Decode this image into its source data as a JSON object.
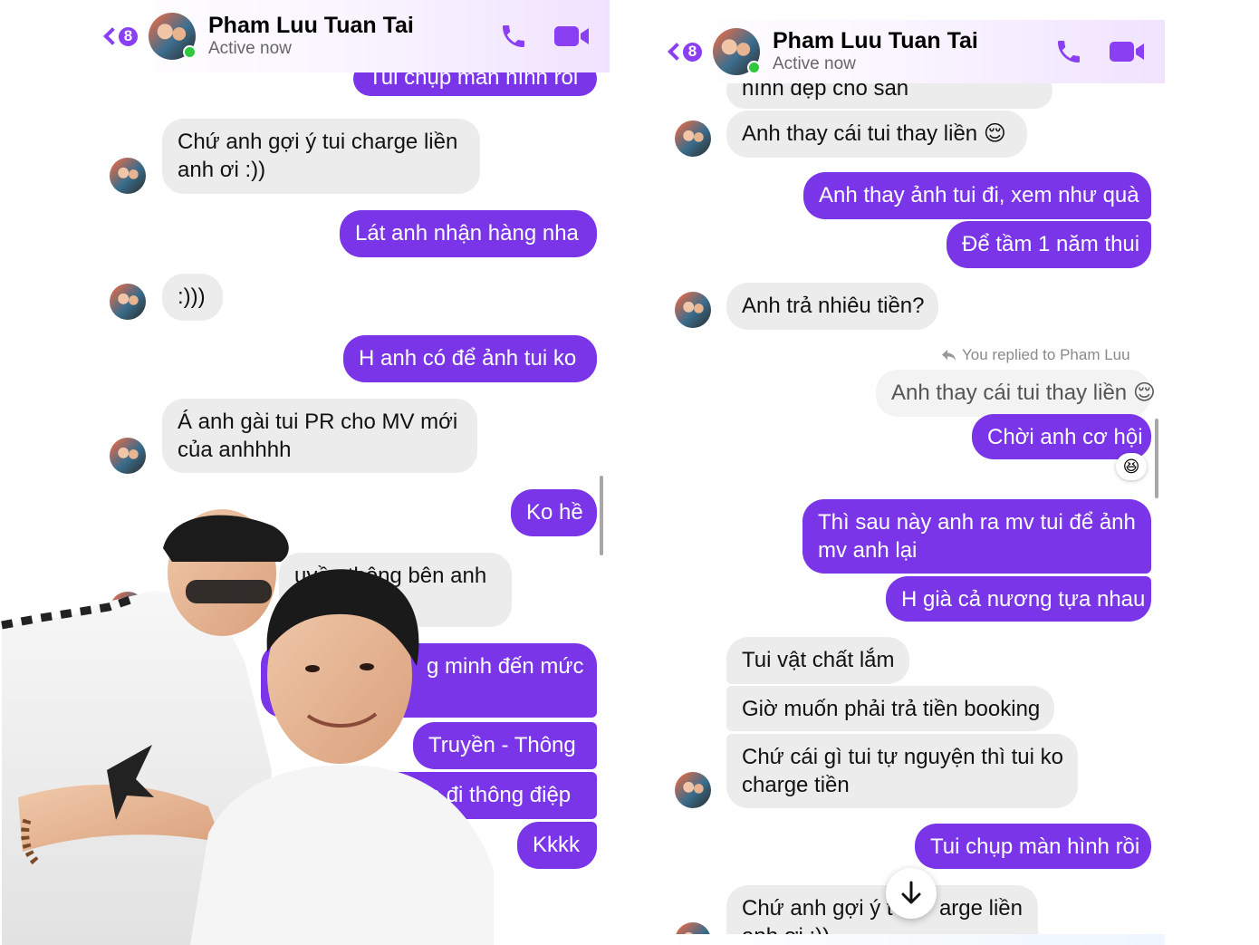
{
  "colors": {
    "accent": "#7a35e8",
    "header_icon": "#8a3ff2",
    "incoming_bubble": "#ececec",
    "online": "#31c840"
  },
  "left": {
    "header": {
      "back_count": "8",
      "name": "Pham Luu Tuan Tai",
      "status": "Active now"
    },
    "messages": [
      "Tui chụp màn hình rồi",
      "Chứ anh gợi ý tui charge liền",
      "anh ơi :))",
      "Lát anh nhận hàng nha",
      ":)))",
      "H anh có để ảnh tui ko",
      "Á anh gài tui PR cho MV mới",
      "của anhhhh",
      "Ko hề",
      "uyền thông bên anh",
      "g minh đến mức",
      "Truyền - Thông",
      "ruyền đi thông điệp",
      "Kkkk"
    ]
  },
  "right": {
    "header": {
      "back_count": "8",
      "name": "Pham Luu Tuan Tai",
      "status": "Active now"
    },
    "messages": [
      "hình đẹp cho sân",
      "Anh thay cái tui thay liền 😌",
      "Anh thay ảnh tui đi, xem như quà",
      "Để tầm 1 năm thui",
      "Anh trả nhiêu tiền?",
      "Anh thay cái tui thay liền 😌",
      "Chời anh cơ hội",
      "Thì sau này anh ra mv tui để ảnh",
      "mv anh lại",
      "H già cả nương tựa nhau",
      "Tui vật chất lắm",
      "Giờ muốn phải trả tiền booking",
      "Chứ cái gì tui tự nguyện thì tui ko",
      "charge tiền",
      "Tui chụp màn hình rồi",
      "Chứ anh gợi ý t",
      "arge liền",
      "anh ơi :))"
    ],
    "replied_note": "You replied to Pham Luu",
    "reaction": "😆"
  },
  "icons": {
    "back": "chevron-left-icon",
    "call": "phone-icon",
    "video": "video-camera-icon",
    "reply": "reply-arrow-icon",
    "scroll": "arrow-down-icon"
  }
}
